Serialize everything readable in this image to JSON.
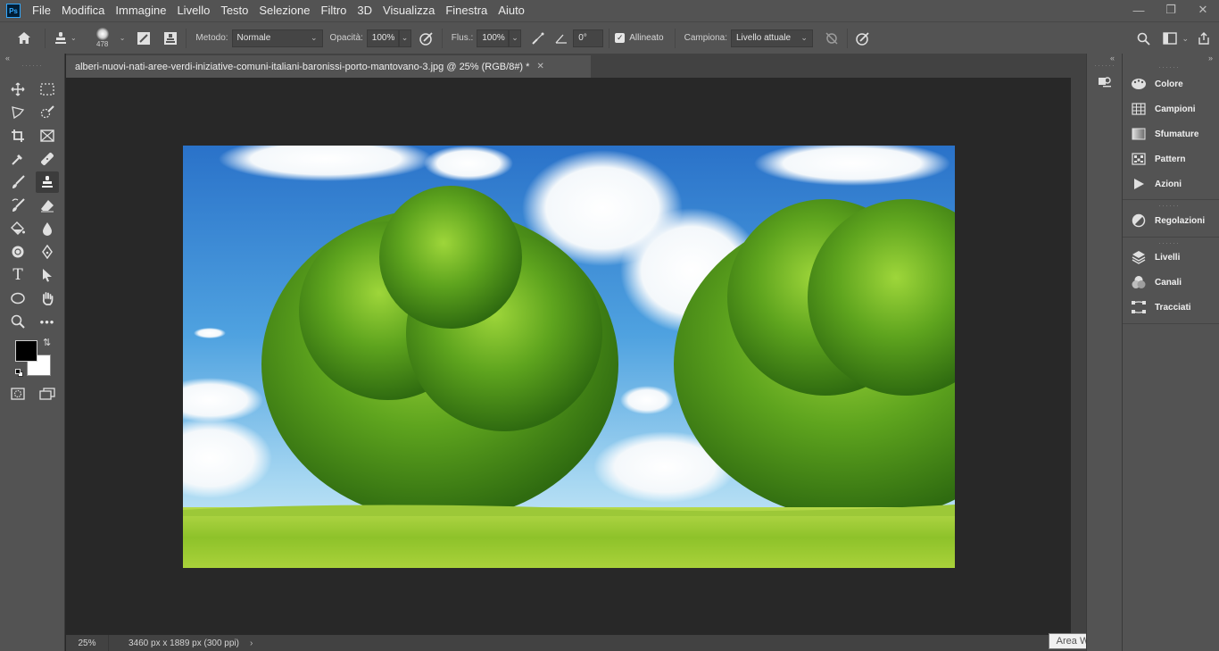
{
  "menu": {
    "app_badge": "Ps",
    "items": [
      "File",
      "Modifica",
      "Immagine",
      "Livello",
      "Testo",
      "Selezione",
      "Filtro",
      "3D",
      "Visualizza",
      "Finestra",
      "Aiuto"
    ]
  },
  "window_controls": [
    "minimize",
    "restore",
    "close"
  ],
  "options_bar": {
    "brush_size": "478",
    "mode_label": "Metodo:",
    "mode_value": "Normale",
    "opacity_label": "Opacità:",
    "opacity_value": "100%",
    "flow_label": "Flus.:",
    "flow_value": "100%",
    "angle_value": "0°",
    "aligned_label": "Allineato",
    "aligned_checked": true,
    "sample_label": "Campiona:",
    "sample_value": "Livello attuale"
  },
  "document": {
    "tab_title": "alberi-nuovi-nati-aree-verdi-iniziative-comuni-italiani-baronissi-porto-mantovano-3.jpg @ 25% (RGB/8#) *"
  },
  "status": {
    "zoom": "25%",
    "doc_info": "3460 px x 1889 px (300 ppi)",
    "more_arrow": "›"
  },
  "tooltip": "Area Windows Ink",
  "right_panel": {
    "group1": [
      "Colore",
      "Campioni",
      "Sfumature",
      "Pattern",
      "Azioni"
    ],
    "group2": [
      "Regolazioni"
    ],
    "group3": [
      "Livelli",
      "Canali",
      "Tracciati"
    ]
  },
  "colors": {
    "foreground": "#000000",
    "background": "#ffffff",
    "ui_panel": "#535353",
    "canvas_bg": "#282828"
  }
}
